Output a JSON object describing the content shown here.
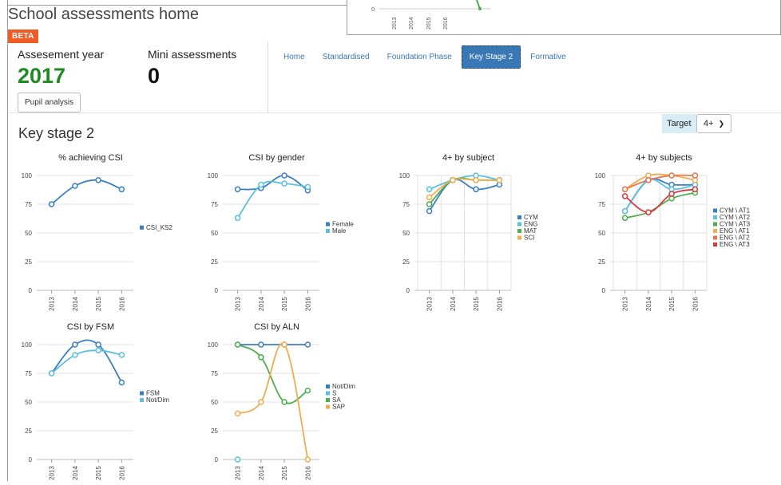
{
  "app": {
    "title": "School assessments home",
    "beta": "BETA"
  },
  "overlay": {
    "y_tick": "0",
    "x_ticks": [
      "2013",
      "2014",
      "2015",
      "2016"
    ]
  },
  "header": {
    "year_label": "Assesement year",
    "year_value": "2017",
    "mini_label": "Mini assessments",
    "mini_value": "0",
    "pupil_button": "Pupil analysis"
  },
  "tabs": [
    {
      "label": "Home",
      "active": false
    },
    {
      "label": "Standardised",
      "active": false
    },
    {
      "label": "Foundation Phase",
      "active": false
    },
    {
      "label": "Key Stage 2",
      "active": true
    },
    {
      "label": "Formative",
      "active": false
    }
  ],
  "section": {
    "title": "Key stage 2",
    "target_label": "Target",
    "target_value": "4+"
  },
  "colors": {
    "accent": "#3a78b5",
    "year_green": "#1f8a1f",
    "beta_orange": "#f05a23"
  },
  "chart_data": [
    {
      "type": "line",
      "title": "% achieving CSI",
      "x": [
        "2013",
        "2014",
        "2015",
        "2016"
      ],
      "ylim": [
        0,
        100
      ],
      "yticks": [
        0,
        25,
        50,
        75,
        100
      ],
      "legend": "right",
      "vgrid": false,
      "series": [
        {
          "name": "CSI_KS2",
          "color": "#3a7fc1",
          "values": [
            75,
            91,
            96,
            88
          ]
        }
      ]
    },
    {
      "type": "line",
      "title": "CSI by gender",
      "x": [
        "2013",
        "2014",
        "2015",
        "2016"
      ],
      "ylim": [
        0,
        100
      ],
      "yticks": [
        0,
        25,
        50,
        75,
        100
      ],
      "legend": "right",
      "vgrid": false,
      "series": [
        {
          "name": "Female",
          "color": "#3a7fc1",
          "values": [
            88,
            89,
            100,
            87
          ]
        },
        {
          "name": "Male",
          "color": "#5bc0de",
          "values": [
            63,
            92,
            93,
            90
          ]
        }
      ]
    },
    {
      "type": "line",
      "title": "4+ by subject",
      "x": [
        "2013",
        "2014",
        "2015",
        "2016"
      ],
      "ylim": [
        0,
        100
      ],
      "yticks": [
        0,
        25,
        50,
        75,
        100
      ],
      "legend": "right",
      "vgrid": true,
      "series": [
        {
          "name": "CYM",
          "color": "#3a7fc1",
          "values": [
            69,
            96,
            88,
            92
          ]
        },
        {
          "name": "ENG",
          "color": "#5bc0de",
          "values": [
            88,
            96,
            100,
            96
          ]
        },
        {
          "name": "MAT",
          "color": "#4cae4c",
          "values": [
            75,
            96,
            96,
            96
          ]
        },
        {
          "name": "SCI",
          "color": "#f0ad4e",
          "values": [
            81,
            96,
            96,
            96
          ]
        }
      ]
    },
    {
      "type": "line",
      "title": "4+ by subjects",
      "x": [
        "2013",
        "2014",
        "2015",
        "2016"
      ],
      "ylim": [
        0,
        100
      ],
      "yticks": [
        0,
        25,
        50,
        75,
        100
      ],
      "legend": "right",
      "vgrid": true,
      "series": [
        {
          "name": "CYM \\ AT1",
          "color": "#3a7fc1",
          "values": [
            69,
            96,
            92,
            92
          ]
        },
        {
          "name": "CYM \\ AT2",
          "color": "#5bc0de",
          "values": [
            69,
            96,
            88,
            92
          ]
        },
        {
          "name": "CYM \\ AT3",
          "color": "#4cae4c",
          "values": [
            63,
            68,
            80,
            85
          ]
        },
        {
          "name": "ENG \\ AT1",
          "color": "#f0ad4e",
          "values": [
            88,
            100,
            100,
            96
          ]
        },
        {
          "name": "ENG \\ AT2",
          "color": "#e8754f",
          "values": [
            88,
            96,
            100,
            100
          ]
        },
        {
          "name": "ENG \\ AT3",
          "color": "#d9363e",
          "values": [
            82,
            68,
            84,
            88
          ]
        }
      ]
    },
    {
      "type": "line",
      "title": "CSI by FSM",
      "x": [
        "2013",
        "2014",
        "2015",
        "2016"
      ],
      "ylim": [
        0,
        100
      ],
      "yticks": [
        0,
        25,
        50,
        75,
        100
      ],
      "legend": "right",
      "vgrid": false,
      "series": [
        {
          "name": "FSM",
          "color": "#3a7fc1",
          "values": [
            75,
            100,
            100,
            67
          ]
        },
        {
          "name": "Not/Dim",
          "color": "#5bc0de",
          "values": [
            75,
            91,
            95,
            91
          ]
        }
      ]
    },
    {
      "type": "line",
      "title": "CSI by ALN",
      "x": [
        "2013",
        "2014",
        "2015",
        "2016"
      ],
      "ylim": [
        0,
        100
      ],
      "yticks": [
        0,
        25,
        50,
        75,
        100
      ],
      "legend": "right",
      "vgrid": false,
      "series": [
        {
          "name": "Not/Dim",
          "color": "#3a7fc1",
          "values": [
            100,
            100,
            100,
            100
          ]
        },
        {
          "name": "S",
          "color": "#5bc0de",
          "values": [
            0,
            null,
            null,
            null
          ]
        },
        {
          "name": "SA",
          "color": "#4cae4c",
          "values": [
            100,
            89,
            50,
            60
          ]
        },
        {
          "name": "SAP",
          "color": "#f0ad4e",
          "values": [
            40,
            50,
            100,
            0
          ]
        }
      ]
    }
  ]
}
